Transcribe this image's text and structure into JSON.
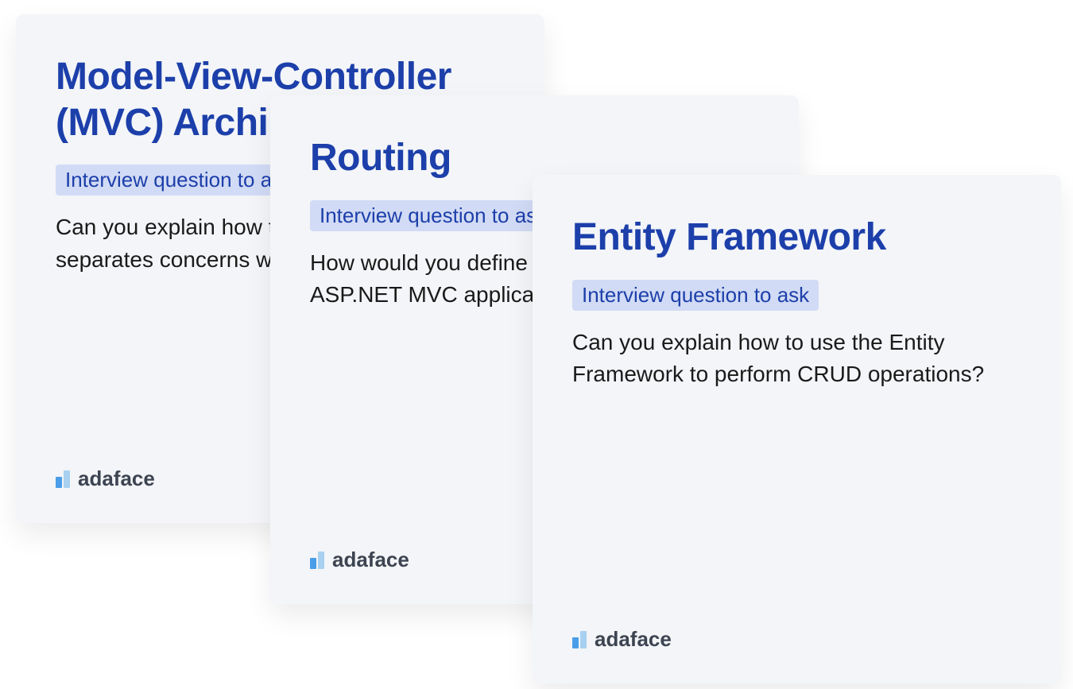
{
  "cards": [
    {
      "title": "Model-View-Controller (MVC) Archi...",
      "badge": "Interview question to ask",
      "question": "Can you explain how the MVC architecture separates concerns within an application?"
    },
    {
      "title": "Routing",
      "badge": "Interview question to ask",
      "question": "How would you define a custom route in an ASP.NET MVC application?"
    },
    {
      "title": "Entity Framework",
      "badge": "Interview question to ask",
      "question": "Can you explain how to use the Entity Framework to perform CRUD operations?"
    }
  ],
  "brand": "adaface"
}
